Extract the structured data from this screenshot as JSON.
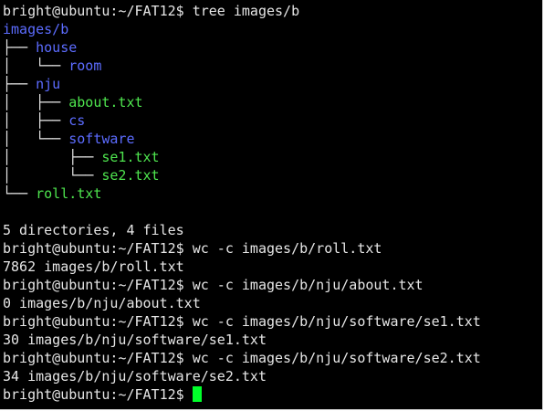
{
  "terminal": {
    "colors": {
      "background": "#000000",
      "text": "#e6e6e6",
      "directory": "#5c6cff",
      "file": "#4ee44e",
      "cursor": "#00ff2a"
    },
    "lines": [
      {
        "prompt": "bright@ubuntu:~/FAT12$",
        "command": "tree images/b"
      },
      {
        "type": "dir",
        "prefix": "",
        "name": "images/b"
      },
      {
        "type": "dir",
        "prefix": "├── ",
        "name": "house"
      },
      {
        "type": "dir",
        "prefix": "│   └── ",
        "name": "room"
      },
      {
        "type": "dir",
        "prefix": "├── ",
        "name": "nju"
      },
      {
        "type": "file",
        "prefix": "│   ├── ",
        "name": "about.txt"
      },
      {
        "type": "dir",
        "prefix": "│   ├── ",
        "name": "cs"
      },
      {
        "type": "dir",
        "prefix": "│   └── ",
        "name": "software"
      },
      {
        "type": "file",
        "prefix": "│       ├── ",
        "name": "se1.txt"
      },
      {
        "type": "file",
        "prefix": "│       └── ",
        "name": "se2.txt"
      },
      {
        "type": "file",
        "prefix": "└── ",
        "name": "roll.txt"
      },
      {
        "output": ""
      },
      {
        "output": "5 directories, 4 files"
      },
      {
        "prompt": "bright@ubuntu:~/FAT12$",
        "command": "wc -c images/b/roll.txt"
      },
      {
        "output": "7862 images/b/roll.txt"
      },
      {
        "prompt": "bright@ubuntu:~/FAT12$",
        "command": "wc -c images/b/nju/about.txt"
      },
      {
        "output": "0 images/b/nju/about.txt"
      },
      {
        "prompt": "bright@ubuntu:~/FAT12$",
        "command": "wc -c images/b/nju/software/se1.txt"
      },
      {
        "output": "30 images/b/nju/software/se1.txt"
      },
      {
        "prompt": "bright@ubuntu:~/FAT12$",
        "command": "wc -c images/b/nju/software/se2.txt"
      },
      {
        "output": "34 images/b/nju/software/se2.txt"
      },
      {
        "prompt": "bright@ubuntu:~/FAT12$",
        "command": "",
        "cursor": true
      }
    ]
  }
}
